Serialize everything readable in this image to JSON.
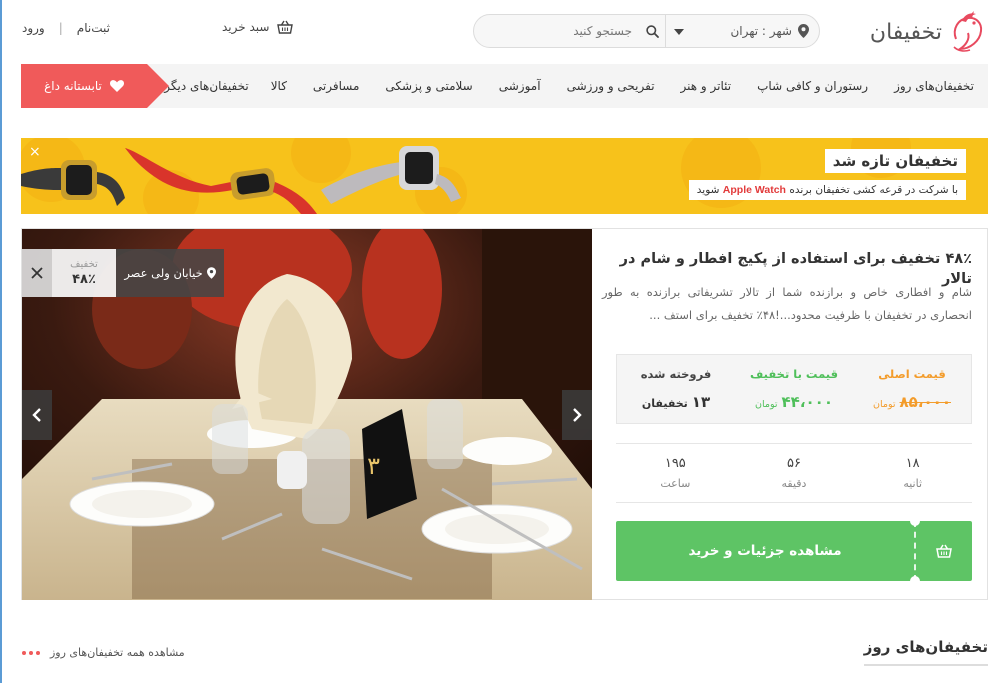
{
  "header": {
    "logo_text": "تخفیفان",
    "city_label": "شهر : تهران",
    "search_placeholder": "جستجو کنید",
    "cart_label": "سبد خرید",
    "register_label": "ثبت‌نام",
    "login_label": "ورود",
    "separator": "|"
  },
  "nav": {
    "items": [
      {
        "label": "تخفیفان‌های روز"
      },
      {
        "label": "رستوران و کافی شاپ"
      },
      {
        "label": "تئاتر و هنر"
      },
      {
        "label": "تفریحی و ورزشی"
      },
      {
        "label": "آموزشی"
      },
      {
        "label": "سلامتی و پزشکی"
      },
      {
        "label": "مسافرتی"
      },
      {
        "label": "کالا"
      }
    ],
    "more_label": "تخفیفان‌های دیگر",
    "wish_label": "تابستانه داغ",
    "wish_color": "#f05a5a"
  },
  "banner": {
    "title": "تخفیفان تازه شد",
    "sub_prefix": "با شرکت در قرعه کشی تخفیفان برنده",
    "sub_brand": "Apple Watch",
    "sub_suffix": "شوید",
    "close": "×",
    "bg_color": "#f7c21b"
  },
  "deal": {
    "title": "۴۸٪ تخفیف برای استفاده از پکیج افطار و شام در تالار",
    "description": "شام و افطاری خاص و برازنده شما از تالار تشریفاتی برازنده به طور انحصاری در تخفیفان با ظرفیت محدود...!۴۸٪ تخفیف برای استف ...",
    "badge": {
      "off_label": "تخفیف",
      "off_value": "۴۸٪",
      "location": "خیابان ولی عصر",
      "category_icon": "fork-knife-icon"
    },
    "prices": {
      "original_label": "قیمت اصلی",
      "original_value": "۸۵،۰۰۰",
      "original_unit": "تومان",
      "discount_label": "قیمت با تخفیف",
      "discount_value": "۴۴،۰۰۰",
      "discount_unit": "تومان",
      "sold_label": "فروخته شده",
      "sold_value": "۱۳",
      "sold_unit": "تخفیفان"
    },
    "timer": [
      {
        "value": "۱۸",
        "label": "ثانیه"
      },
      {
        "value": "۵۶",
        "label": "دقیقه"
      },
      {
        "value": "۱۹۵",
        "label": "ساعت"
      }
    ],
    "buy_label": "مشاهده جزئیات و خرید",
    "buy_color": "#5ec465"
  },
  "section": {
    "title": "تخفیفان‌های روز",
    "see_all": "مشاهده همه تخفیفان‌های روز"
  }
}
